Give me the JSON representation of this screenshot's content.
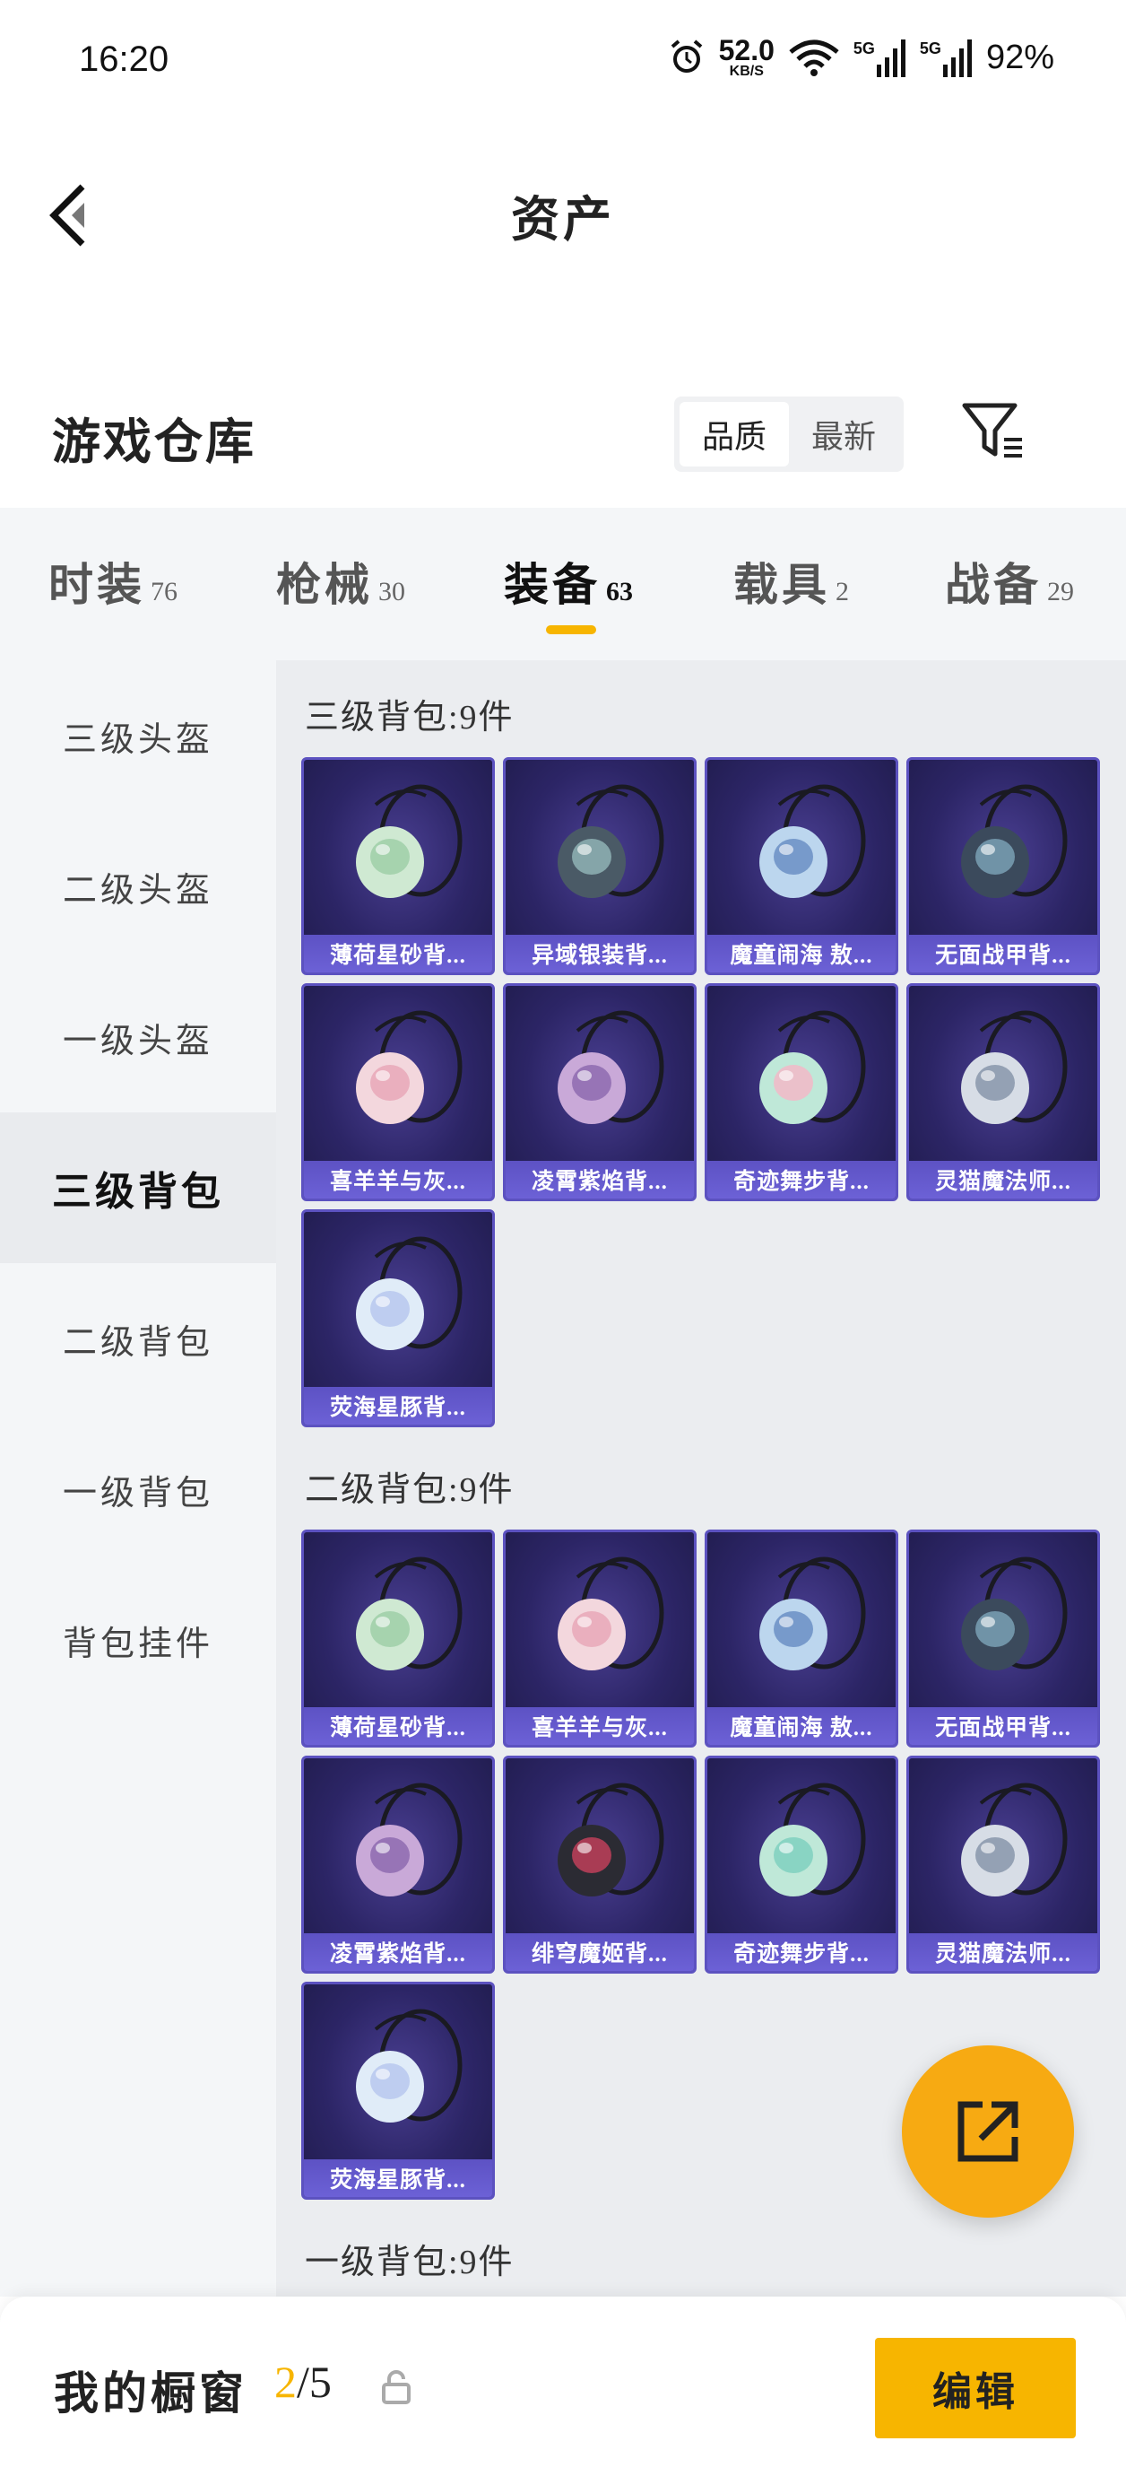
{
  "status_bar": {
    "time": "16:20",
    "net_speed": "52.0",
    "net_unit": "KB/S",
    "signal1_label": "5G",
    "signal2_label": "5G",
    "battery": "92%"
  },
  "header": {
    "title": "资产"
  },
  "warehouse": {
    "title": "游戏仓库",
    "sort_options": [
      "品质",
      "最新"
    ],
    "active_sort": "品质"
  },
  "tabs": [
    {
      "label": "时装",
      "count": "76"
    },
    {
      "label": "枪械",
      "count": "30"
    },
    {
      "label": "装备",
      "count": "63"
    },
    {
      "label": "载具",
      "count": "2"
    },
    {
      "label": "战备",
      "count": "29"
    }
  ],
  "active_tab": "装备",
  "sidebar": {
    "items": [
      "三级头盔",
      "二级头盔",
      "一级头盔",
      "三级背包",
      "二级背包",
      "一级背包",
      "背包挂件"
    ],
    "active": "三级背包"
  },
  "sections": [
    {
      "title": "三级背包:9件",
      "items": [
        "薄荷星砂背...",
        "异域银装背...",
        "魔童闹海 敖...",
        "无面战甲背...",
        "喜羊羊与灰...",
        "凌霄紫焰背...",
        "奇迹舞步背...",
        "灵猫魔法师...",
        "荧海星豚背..."
      ]
    },
    {
      "title": "二级背包:9件",
      "items": [
        "薄荷星砂背...",
        "喜羊羊与灰...",
        "魔童闹海 敖...",
        "无面战甲背...",
        "凌霄紫焰背...",
        "绯穹魔姬背...",
        "奇迹舞步背...",
        "灵猫魔法师...",
        "荧海星豚背..."
      ]
    },
    {
      "title": "一级背包:9件",
      "items": []
    }
  ],
  "bottom_bar": {
    "window_label": "我的橱窗",
    "window_current": "2",
    "window_separator": "/",
    "window_max": "5",
    "edit_label": "编辑"
  },
  "colors": {
    "accent": "#f7b500",
    "fab": "#f7aa12",
    "card_border": "#5c52c0",
    "card_label_bg": "#6c61d6"
  },
  "icons": {
    "back": "back-arrow-icon",
    "filter": "filter-icon",
    "fab": "share-external-icon",
    "lock": "lock-icon"
  }
}
